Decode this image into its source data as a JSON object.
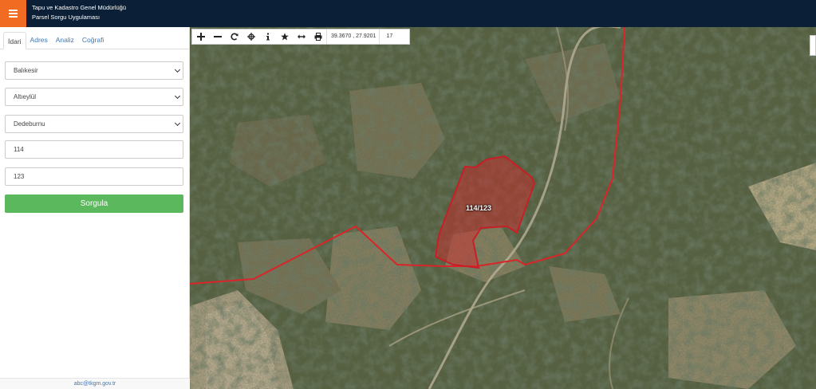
{
  "header": {
    "title": "Tapu ve Kadastro Genel Müdürlüğü",
    "subtitle": "Parsel Sorgu Uygulaması",
    "menu_icon": "hamburger-icon",
    "brand_color": "#f26b22",
    "header_color": "#0b2036"
  },
  "sidebar": {
    "tabs": [
      {
        "label": "İdari",
        "active": true
      },
      {
        "label": "Adres",
        "active": false
      },
      {
        "label": "Analiz",
        "active": false
      },
      {
        "label": "Coğrafi",
        "active": false
      }
    ],
    "province": "Balıkesir",
    "district": "Altıeylül",
    "neighborhood": "Dedeburnu",
    "block": "114",
    "parcel": "123",
    "query_button": "Sorgula",
    "query_button_color": "#5cb85c",
    "footer": "abc@tkgm.gov.tr"
  },
  "map": {
    "tools": [
      "zoom-in-icon",
      "zoom-out-icon",
      "refresh-icon",
      "crosshair-icon",
      "info-icon",
      "star-icon",
      "measure-icon",
      "print-icon"
    ],
    "coordinates": "39.3670 , 27.9201",
    "zoom_level": "17",
    "parcel_label": "114/123",
    "boundary_color": "#d9252a"
  }
}
